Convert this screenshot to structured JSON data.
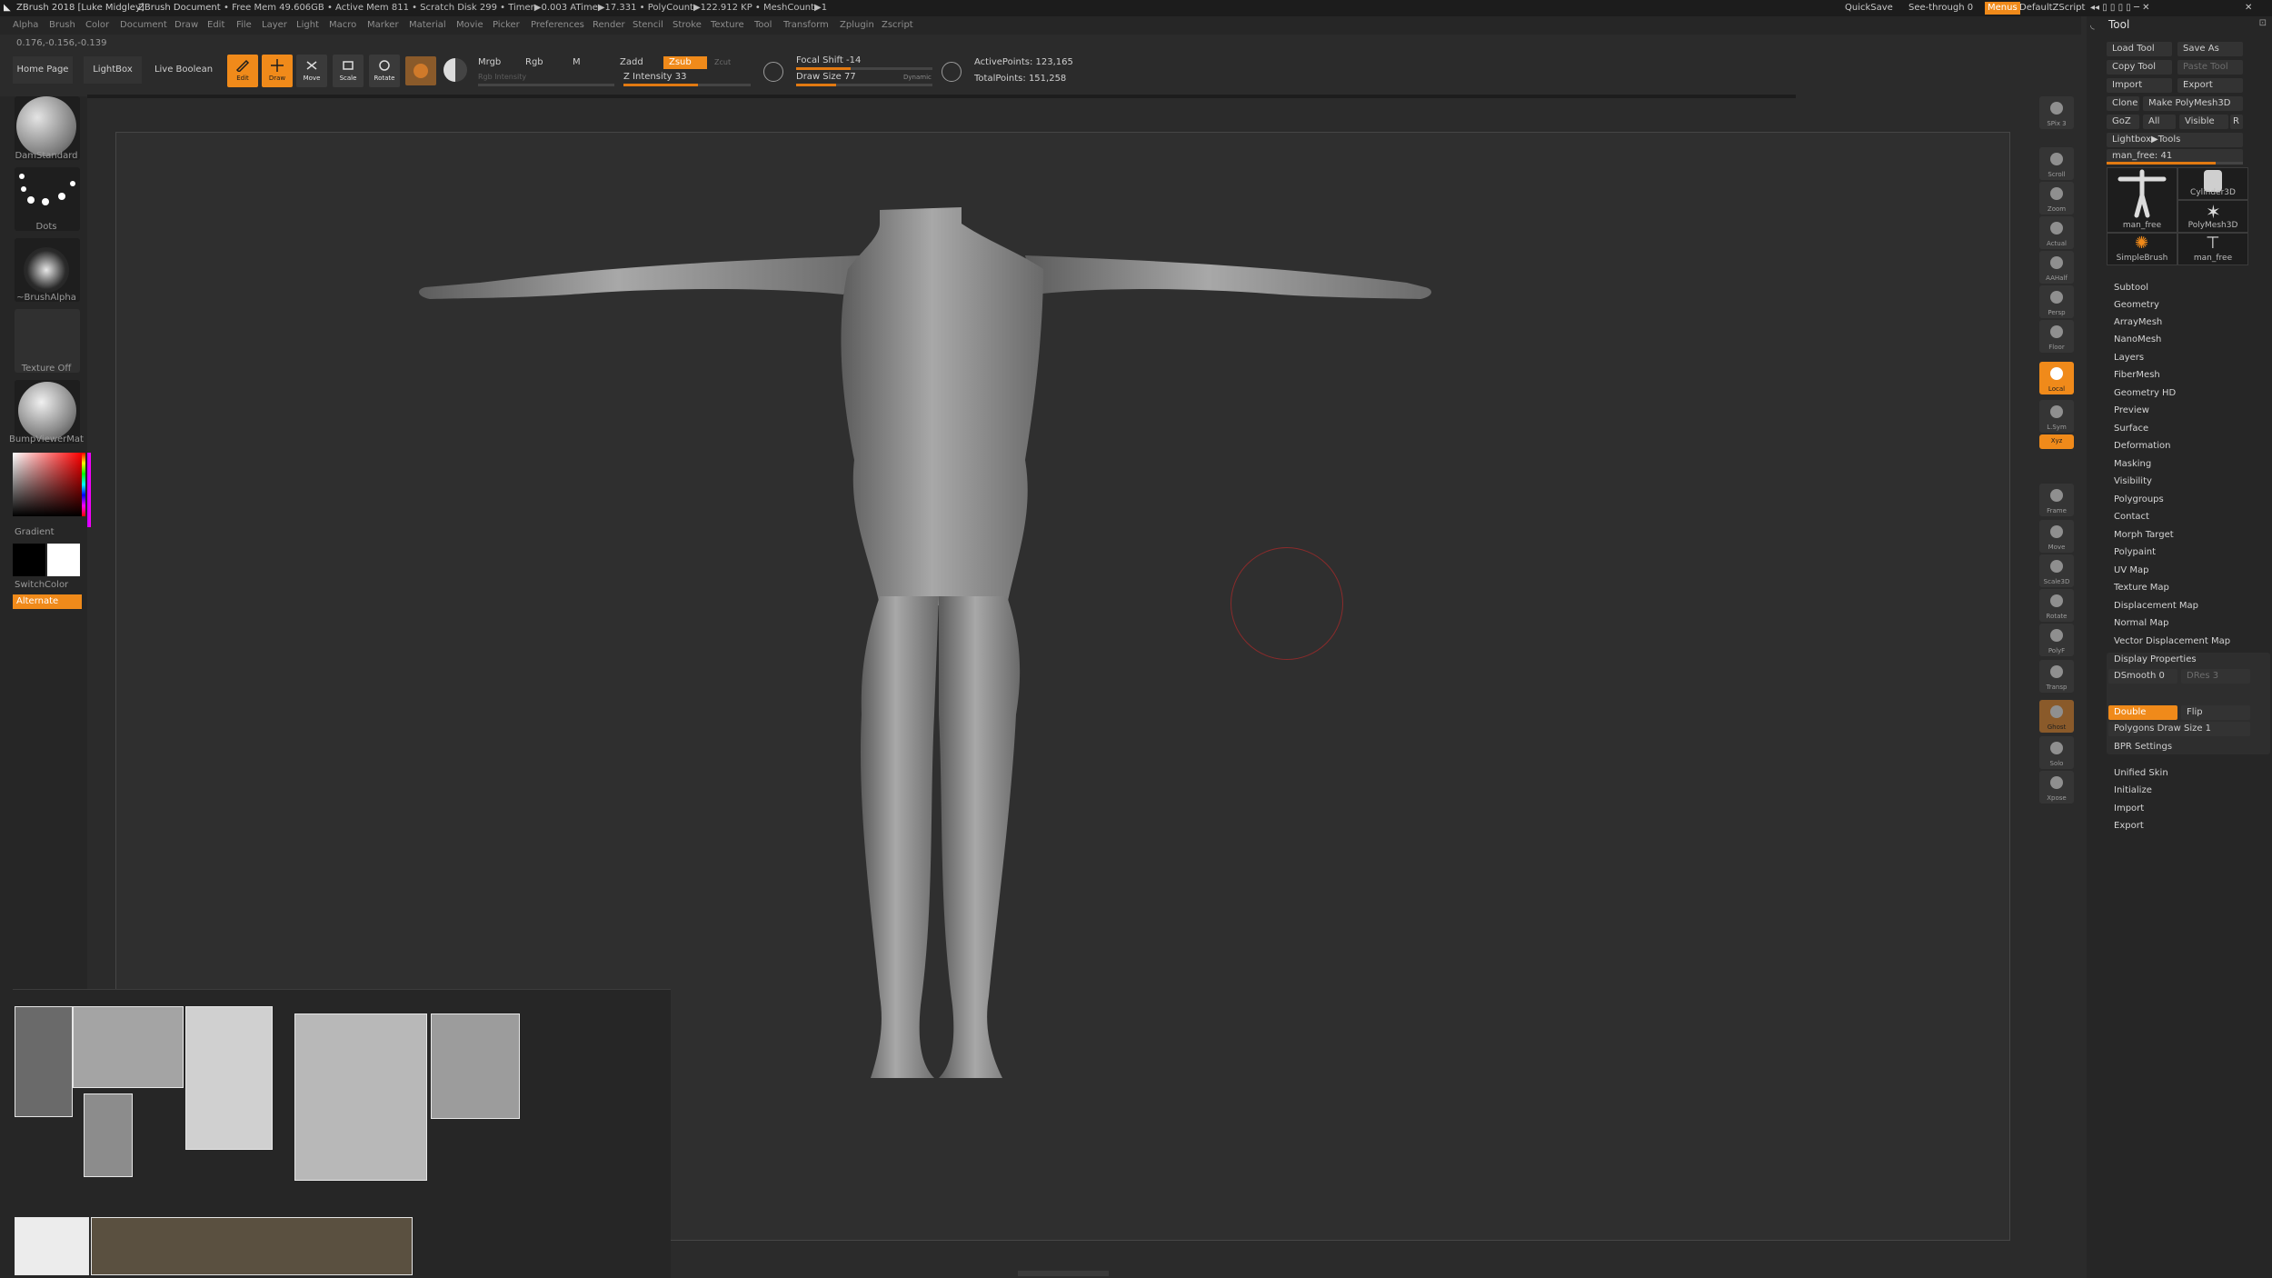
{
  "titlebar": {
    "app": "ZBrush 2018 [Luke Midgley]",
    "doc": "ZBrush Document",
    "stats": "• Free Mem 49.606GB • Active Mem 811 • Scratch Disk 299 • Timer▶0.003 ATime▶17.331 • PolyCount▶122.912 KP • MeshCount▶1",
    "quicksave": "QuickSave",
    "see_through": "See-through 0",
    "menus": "Menus",
    "script": "DefaultZScript"
  },
  "menubar": [
    "Alpha",
    "Brush",
    "Color",
    "Document",
    "Draw",
    "Edit",
    "File",
    "Layer",
    "Light",
    "Macro",
    "Marker",
    "Material",
    "Movie",
    "Picker",
    "Preferences",
    "Render",
    "Stencil",
    "Stroke",
    "Texture",
    "Tool",
    "Transform",
    "Zplugin",
    "Zscript"
  ],
  "coords": "0.176,-0.156,-0.139",
  "shelf": {
    "home": "Home Page",
    "lightbox": "LightBox",
    "boolean": "Live Boolean",
    "tools": [
      {
        "label": "Edit",
        "icon": "edit-icon",
        "active": true
      },
      {
        "label": "Draw",
        "icon": "draw-icon",
        "active": true
      },
      {
        "label": "Move",
        "icon": "move-icon",
        "active": false
      },
      {
        "label": "Scale",
        "icon": "scale-icon",
        "active": false
      },
      {
        "label": "Rotate",
        "icon": "rotate-icon",
        "active": false
      }
    ],
    "mrgb": "Mrgb",
    "rgb": "Rgb",
    "m": "M",
    "rgb_intensity": "Rgb Intensity",
    "zadd": "Zadd",
    "zsub": "Zsub",
    "zcut": "Zcut",
    "z_intensity": "Z Intensity 33",
    "z_intensity_value": 33,
    "focal_shift": "Focal Shift -14",
    "draw_size": "Draw Size 77",
    "dynamic": "Dynamic",
    "active_points": "ActivePoints: 123,165",
    "total_points": "TotalPoints: 151,258"
  },
  "left_tray": {
    "brush": "DamStandard",
    "stroke": "Dots",
    "alpha": "~BrushAlpha",
    "texture": "Texture Off",
    "material": "BumpViewerMat",
    "gradient": "Gradient",
    "switchcolor": "SwitchColor",
    "alternate": "Alternate"
  },
  "right_shelf": [
    {
      "label": "SPix 3",
      "icon": "bpr-icon",
      "on": false
    },
    {
      "label": "Scroll",
      "icon": "scroll-icon",
      "on": false
    },
    {
      "label": "Zoom",
      "icon": "zoom-icon",
      "on": false
    },
    {
      "label": "Actual",
      "icon": "actual-icon",
      "on": false
    },
    {
      "label": "AAHalf",
      "icon": "aahalf-icon",
      "on": false
    },
    {
      "label": "Persp",
      "icon": "persp-icon",
      "on": false
    },
    {
      "label": "Floor",
      "icon": "floor-icon",
      "on": false
    },
    {
      "label": "Local",
      "icon": "local-icon",
      "on": true
    },
    {
      "label": "L.Sym",
      "icon": "lsym-icon",
      "on": false
    },
    {
      "label": "Xyz",
      "icon": "xyz-icon",
      "on": true
    },
    {
      "label": "Frame",
      "icon": "frame-icon",
      "on": false
    },
    {
      "label": "Move",
      "icon": "move-icon",
      "on": false
    },
    {
      "label": "Scale3D",
      "icon": "scale3d-icon",
      "on": false
    },
    {
      "label": "Rotate",
      "icon": "rotate-icon",
      "on": false
    },
    {
      "label": "PolyF",
      "icon": "polyf-icon",
      "on": false
    },
    {
      "label": "Transp",
      "icon": "transp-icon",
      "on": false
    },
    {
      "label": "Ghost",
      "icon": "ghost-icon",
      "on": true
    },
    {
      "label": "Solo",
      "icon": "solo-icon",
      "on": false
    },
    {
      "label": "Xpose",
      "icon": "xpose-icon",
      "on": false
    }
  ],
  "tool_palette": {
    "title": "Tool",
    "load_tool": "Load Tool",
    "save_as": "Save As",
    "copy_tool": "Copy Tool",
    "paste_tool": "Paste Tool",
    "import": "Import",
    "export": "Export",
    "clone": "Clone",
    "make_polymesh": "Make PolyMesh3D",
    "goz": "GoZ",
    "all": "All",
    "visible": "Visible",
    "r": "R",
    "lightbox_tools": "Lightbox▶Tools",
    "current_tool": "man_free: 41",
    "thumbs": [
      "man_free",
      "Cylinder3D",
      "PolyMesh3D",
      "SimpleBrush",
      "man_free"
    ],
    "sections": [
      "Subtool",
      "Geometry",
      "ArrayMesh",
      "NanoMesh",
      "Layers",
      "FiberMesh",
      "Geometry HD",
      "Preview",
      "Surface",
      "Deformation",
      "Masking",
      "Visibility",
      "Polygroups",
      "Contact",
      "Morph Target",
      "Polypaint",
      "UV Map",
      "Texture Map",
      "Displacement Map",
      "Normal Map",
      "Vector Displacement Map",
      "Display Properties"
    ],
    "dsmooth": "DSmooth 0",
    "dres": "DRes 3",
    "double": "Double",
    "flip": "Flip",
    "poly_draw_size": "Polygons Draw Size 1",
    "bpr_settings": "BPR Settings",
    "bottom": [
      "Unified Skin",
      "Initialize",
      "Import",
      "Export"
    ]
  }
}
